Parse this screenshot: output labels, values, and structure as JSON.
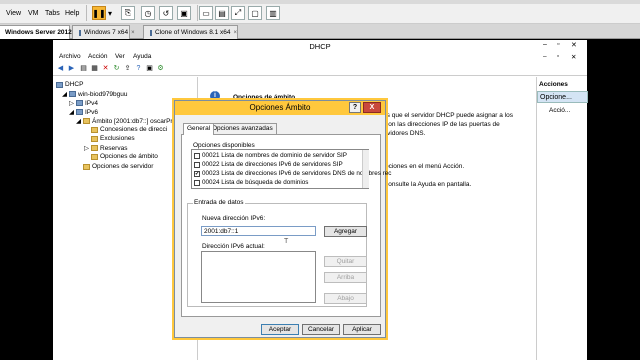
{
  "vm_toolbar": {
    "menus": [
      "View",
      "VM",
      "Tabs",
      "Help"
    ]
  },
  "tabs": [
    {
      "label": "Windows Server 2012",
      "active": true
    },
    {
      "label": "Windows 7 x64",
      "active": false
    },
    {
      "label": "Clone of Windows 8.1 x64",
      "active": false
    }
  ],
  "dhcp": {
    "title": "DHCP",
    "menu": [
      "Archivo",
      "Acción",
      "Ver",
      "Ayuda"
    ]
  },
  "tree": {
    "root": "DHCP",
    "server": "win-biod979bguu",
    "ipv4": "IPv4",
    "ipv6": "IPv6",
    "scope": "Ámbito [2001:db7::] oscarPr",
    "leases": "Concesiones de direcci",
    "exclusions": "Exclusiones",
    "reservations": "Reservas",
    "scope_options": "Opciones de ámbito",
    "server_options": "Opciones de servidor"
  },
  "content": {
    "heading": "Opciones de ámbito",
    "line1": "ales que el servidor DHCP puede asignar a los",
    "line2": "son las direcciones IP de las puertas de",
    "line3": "rvidores DNS.",
    "line4": "pciones en el menú Acción.",
    "line5": "consulte la Ayuda en pantalla."
  },
  "actions": {
    "header": "Acciones",
    "selected": "Opcione...",
    "item": "Acció..."
  },
  "dialog": {
    "title": "Opciones Ámbito",
    "help": "?",
    "close": "X",
    "tab_general": "General",
    "tab_advanced": "Opciones avanzadas",
    "available_label": "Opciones disponibles",
    "options": [
      {
        "label": "00021 Lista de nombres de dominio de servidor SIP",
        "checked": false
      },
      {
        "label": "00022 Lista de direcciones IPv6 de servidores SIP",
        "checked": false
      },
      {
        "label": "00023 Lista de direcciones IPv6 de servidores DNS de nombres rec",
        "checked": true
      },
      {
        "label": "00024 Lista de búsqueda de dominios",
        "checked": false
      }
    ],
    "entry_label": "Entrada de datos",
    "new_ipv6_label": "Nueva dirección IPv6:",
    "new_ipv6_value": "2001:db7::1",
    "add_button": "Agregar",
    "current_ipv6_label": "Dirección IPv6 actual:",
    "remove_button": "Quitar",
    "up_button": "Arriba",
    "down_button": "Abajo",
    "ok_button": "Aceptar",
    "cancel_button": "Cancelar",
    "apply_button": "Aplicar"
  },
  "colors": {
    "dialog_title": "#ffc83d",
    "close_red": "#c9483c",
    "selected_action": "#d4e4f4"
  }
}
